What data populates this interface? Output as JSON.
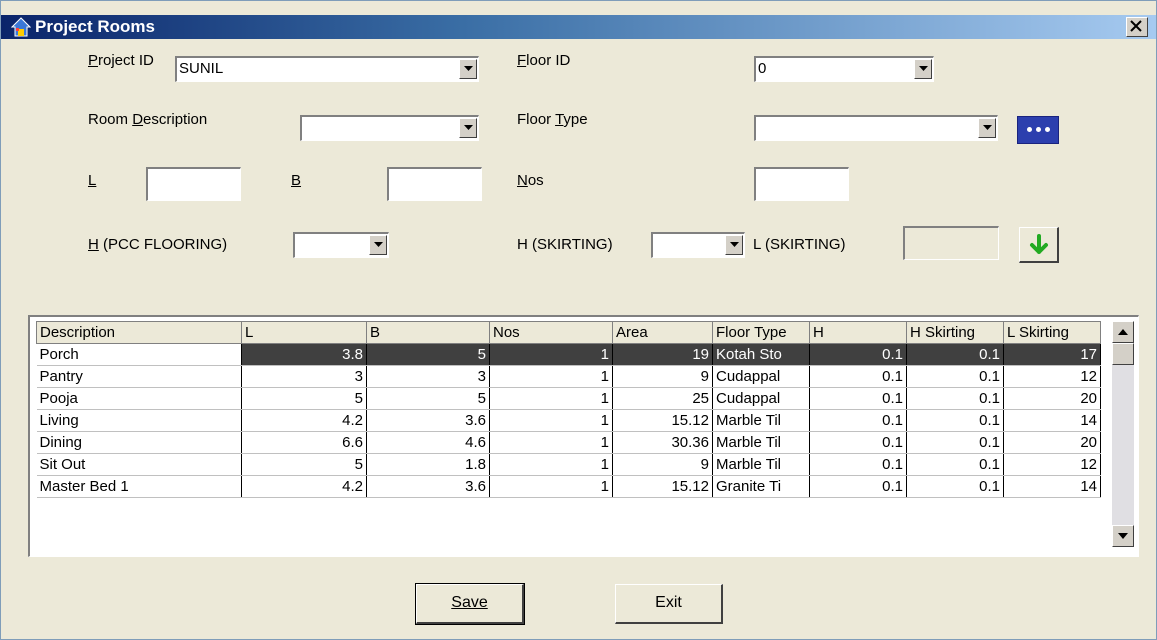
{
  "window": {
    "title": "Project Rooms",
    "close_glyph": "×"
  },
  "form": {
    "project_id": {
      "label": "Project ID",
      "value": "SUNIL"
    },
    "floor_id": {
      "label": "Floor ID",
      "value": "0"
    },
    "room_description": {
      "label": "Room Description",
      "value": ""
    },
    "floor_type": {
      "label": "Floor Type",
      "value": ""
    },
    "length": {
      "label": "L",
      "value": ""
    },
    "breadth": {
      "label": "B",
      "value": ""
    },
    "nos": {
      "label": "Nos",
      "value": ""
    },
    "h_pcc": {
      "label": "H (PCC FLOORING)",
      "value": ""
    },
    "h_skirting": {
      "label": "H (SKIRTING)",
      "value": ""
    },
    "l_skirting": {
      "label": "L (SKIRTING)",
      "value": ""
    }
  },
  "grid": {
    "columns": [
      "Description",
      "L",
      "B",
      "Nos",
      "Area",
      "Floor Type",
      "H",
      "H Skirting",
      "L Skirting"
    ],
    "rows": [
      [
        "Porch",
        "3.8",
        "5",
        "1",
        "19",
        "Kotah Sto",
        "0.1",
        "0.1",
        "17"
      ],
      [
        "Pantry",
        "3",
        "3",
        "1",
        "9",
        "Cudappal",
        "0.1",
        "0.1",
        "12"
      ],
      [
        "Pooja",
        "5",
        "5",
        "1",
        "25",
        "Cudappal",
        "0.1",
        "0.1",
        "20"
      ],
      [
        "Living",
        "4.2",
        "3.6",
        "1",
        "15.12",
        "Marble Til",
        "0.1",
        "0.1",
        "14"
      ],
      [
        "Dining",
        "6.6",
        "4.6",
        "1",
        "30.36",
        "Marble Til",
        "0.1",
        "0.1",
        "20"
      ],
      [
        "Sit Out",
        "5",
        "1.8",
        "1",
        "9",
        "Marble Til",
        "0.1",
        "0.1",
        "12"
      ],
      [
        "Master Bed 1",
        "4.2",
        "3.6",
        "1",
        "15.12",
        "Granite Ti",
        "0.1",
        "0.1",
        "14"
      ]
    ],
    "selected_row": 0
  },
  "buttons": {
    "save": "Save",
    "exit": "Exit"
  },
  "icons": {
    "app": "house-icon",
    "ellipsis": "ellipsis-icon",
    "add": "green-down-arrow-icon",
    "dropdown": "triangle-down-icon"
  },
  "colors": {
    "selection": "#404040",
    "ellipsis_button": "#2c3fae",
    "add_arrow": "#22aa22"
  }
}
